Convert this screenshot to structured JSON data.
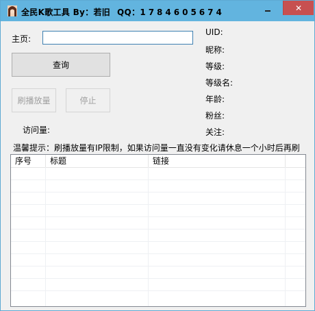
{
  "window": {
    "title": "全民K歌工具 By：若旧",
    "qq_label": "QQ：",
    "qq_value": "1784605674",
    "colors": {
      "titlebar": "#62b4df",
      "close_button": "#c75050",
      "border": "#5da9d3"
    },
    "close_glyph": "✕"
  },
  "form": {
    "homepage_label": "主页:",
    "homepage_value": "",
    "query_button": "查询",
    "boost_button": "刷播放量",
    "stop_button": "停止",
    "visits_label": "访问量:"
  },
  "profile": {
    "uid": "UID:",
    "nickname": "昵称:",
    "level": "等级:",
    "level_name": "等级名:",
    "age": "年龄:",
    "fans": "粉丝:",
    "following": "关注:"
  },
  "notice": "温馨提示：刷播放量有IP限制，如果访问量一直没有变化请休息一个小时后再刷",
  "table": {
    "columns": [
      "序号",
      "标题",
      "链接"
    ]
  }
}
